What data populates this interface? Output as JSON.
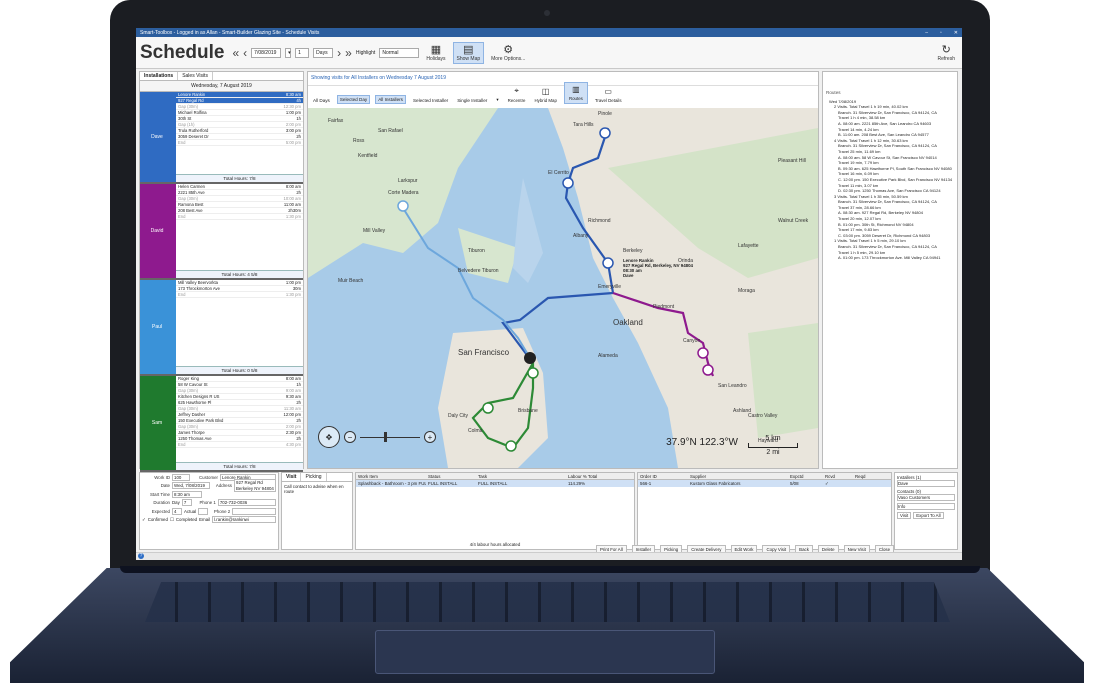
{
  "window": {
    "title": "Smart-Toolbox - Logged in as Allan - Smart-Builder Glazing Site - Schedule Visits"
  },
  "toolbar": {
    "heading": "Schedule",
    "date_value": "7/08/2019",
    "days_count": "1",
    "days_unit": "Days",
    "highlight_label": "Highlight",
    "highlight_value": "Normal",
    "holidays_label": "Holidays",
    "showmap_label": "Show Map",
    "moreoptions_label": "More Options...",
    "refresh_label": "Refresh"
  },
  "left": {
    "tabs": [
      "Installations",
      "Sales Visits"
    ],
    "day_header": "Wednesday, 7 August 2019",
    "installers": [
      {
        "name": "Dave",
        "color": "#2f6bc2",
        "jobs": [
          {
            "t": "Lenore Rankin",
            "v": "8:30 am",
            "sel": true
          },
          {
            "t": "927 Regal Rd",
            "v": "4h",
            "sel": true
          },
          {
            "t": "Gap (30m)",
            "v": "12:30 pm",
            "gap": true
          },
          {
            "t": "Michael Rolfina",
            "v": "1:00 pm"
          },
          {
            "t": "30th St",
            "v": "1h"
          },
          {
            "t": "Gap (1h)",
            "v": "2:00 pm",
            "gap": true
          },
          {
            "t": "Trula Rutherford",
            "v": "3:00 pm"
          },
          {
            "t": "3059 Deseret Dr",
            "v": "2h"
          },
          {
            "t": "End",
            "v": "5:00 pm",
            "gap": true
          }
        ],
        "total": "Total Hours: 7/8"
      },
      {
        "name": "David",
        "color": "#8e1a8e",
        "jobs": [
          {
            "t": "Helen Carmen",
            "v": "8:00 am"
          },
          {
            "t": "2221 85th Ave",
            "v": "2h"
          },
          {
            "t": "Gap (30m)",
            "v": "10:00 am",
            "gap": true
          },
          {
            "t": "Ramona Best",
            "v": "11:00 am"
          },
          {
            "t": "208 Best Ave",
            "v": "2h30m"
          },
          {
            "t": "End",
            "v": "1:30 pm",
            "gap": true
          }
        ],
        "total": "Total Hours: 4 5/8"
      },
      {
        "name": "Paul",
        "color": "#3a92d8",
        "jobs": [
          {
            "t": "Mill Valley Beervorkta",
            "v": "1:00 pm"
          },
          {
            "t": "173 Throckmorton Ave",
            "v": "30m"
          },
          {
            "t": "End",
            "v": "1:30 pm",
            "gap": true
          }
        ],
        "total": "Total Hours: 0 5/8"
      },
      {
        "name": "Sam",
        "color": "#1f7a2e",
        "jobs": [
          {
            "t": "Roger King",
            "v": "8:00 am"
          },
          {
            "t": "58 W Cavour St",
            "v": "1h"
          },
          {
            "t": "Gap (30m)",
            "v": "9:00 am",
            "gap": true
          },
          {
            "t": "Kitchen Designs R US",
            "v": "9:30 am"
          },
          {
            "t": "625 Hawthorne Pl",
            "v": "2h"
          },
          {
            "t": "Gap (30m)",
            "v": "11:30 am",
            "gap": true
          },
          {
            "t": "Jeffrey Dasher",
            "v": "12:00 pm"
          },
          {
            "t": "150 Executive Park Blvd",
            "v": "2h"
          },
          {
            "t": "Gap (30m)",
            "v": "2:00 pm",
            "gap": true
          },
          {
            "t": "James Thorpe",
            "v": "2:30 pm"
          },
          {
            "t": "1250 Thomas Ave",
            "v": "2h"
          },
          {
            "t": "End",
            "v": "4:30 pm",
            "gap": true
          }
        ],
        "total": "Total Hours: 7/8"
      }
    ]
  },
  "map": {
    "header": "Showing visits for All Installers on Wednesday 7 August 2019",
    "tools": [
      "All Days",
      "Selected Day",
      "All Installers",
      "Selected Installer",
      "Single Installer",
      "Recentre",
      "Hybrid Map",
      "Routes",
      "Travel Details"
    ],
    "labels": [
      "Fairfax",
      "San Rafael",
      "Ross",
      "Kentfield",
      "Larkspur",
      "Corte Madera",
      "Mill Valley",
      "Muir Beach",
      "Tiburon",
      "Belvedere Tiburon",
      "Richmond",
      "El Cerrito",
      "Albany",
      "Berkeley",
      "Emeryville",
      "Piedmont",
      "Oakland",
      "Alameda",
      "San Francisco",
      "Daly City",
      "Brisbane",
      "Colma",
      "San Leandro",
      "Hayward",
      "Castro Valley",
      "Ashland",
      "Moraga",
      "Lafayette",
      "Orinda",
      "Canyon",
      "Walnut Creek",
      "Pleasant Hill",
      "Pinole",
      "Tara Hills"
    ],
    "callout": [
      "Lenore Rankin",
      "927 Regal Rd, Berkeley, NV 94804",
      "08:30 am",
      "Dave"
    ],
    "coords": "37.9°N  122.3°W",
    "scale_km": "5 km",
    "scale_mi": "2 mi"
  },
  "routes": {
    "title": "Routes",
    "lines": [
      {
        "lvl": 1,
        "t": "Wed 7/08/2019"
      },
      {
        "lvl": 2,
        "t": "2 Visits. Total Travel 1 h 19 min, 40.02 km"
      },
      {
        "lvl": 3,
        "t": "Branch. 31 Silverview Dr, San Francisco, CA 94124, CA"
      },
      {
        "lvl": 3,
        "t": "Travel 1 h 4 min, 38.58 km"
      },
      {
        "lvl": 3,
        "t": "A. 08:00 am. 2221 85th Ave, San Leandro CA 94603"
      },
      {
        "lvl": 3,
        "t": "Travel 14 min, 4.24 km"
      },
      {
        "lvl": 3,
        "t": "B. 11:00 am. 208 Best Ave, San Leandro CA 94577"
      },
      {
        "lvl": 2,
        "t": "4 Visits. Total Travel 1 h 12 min, 30.63 km"
      },
      {
        "lvl": 3,
        "t": "Branch. 31 Silverview Dr, San Francisco, CA 94124, CA"
      },
      {
        "lvl": 3,
        "t": "Travel 25 min, 11.69 km"
      },
      {
        "lvl": 3,
        "t": "A. 08:00 am. 58 W Cavour St, San Francisco NV 94014"
      },
      {
        "lvl": 3,
        "t": "Travel 19 min, 7.79 km"
      },
      {
        "lvl": 3,
        "t": "B. 09:30 am. 625 Hawthorne Pl, South San Francisco NV 94080"
      },
      {
        "lvl": 3,
        "t": "Travel 16 min, 6.09 km"
      },
      {
        "lvl": 3,
        "t": "C. 12:00 pm. 150 Executive Park Blvd, San Francisco NV 94134"
      },
      {
        "lvl": 3,
        "t": "Travel 11 min, 3.07 km"
      },
      {
        "lvl": 3,
        "t": "D. 02:30 pm. 1250 Thomas Ave, San Francisco CA 94124"
      },
      {
        "lvl": 2,
        "t": "3 Visits. Total Travel 1 h 35 min, 50.59 km"
      },
      {
        "lvl": 3,
        "t": "Branch. 31 Silverview Dr, San Francisco, CA 94124, CA"
      },
      {
        "lvl": 3,
        "t": "Travel 37 min, 28.66 km"
      },
      {
        "lvl": 3,
        "t": "A. 08:30 am. 927 Regal Rd, Berkeley NV 94804"
      },
      {
        "lvl": 3,
        "t": "Travel 20 min, 12.07 km"
      },
      {
        "lvl": 3,
        "t": "B. 01:00 pm. 30th St, Richmond NV 94804"
      },
      {
        "lvl": 3,
        "t": "Travel 17 min, 9.83 km"
      },
      {
        "lvl": 3,
        "t": "C. 03:00 pm. 3059 Deseret Dr, Richmond CA 94803"
      },
      {
        "lvl": 2,
        "t": "1 Visits. Total Travel 1 h 5 min, 29.10 km"
      },
      {
        "lvl": 3,
        "t": "Branch. 31 Silverview Dr, San Francisco, CA 94124, CA"
      },
      {
        "lvl": 3,
        "t": "Travel 1 h 5 min, 29.10 km"
      },
      {
        "lvl": 3,
        "t": "A. 01:00 pm. 173 Throckmorton Ave. Mill Valley CA 94941"
      }
    ]
  },
  "bottom": {
    "work_id_label": "Work ID",
    "work_id": "100",
    "customer_label": "Customer",
    "customer": "Lenore Rankin",
    "date_label": "Date",
    "date": "Wed, 7/08/2019",
    "address_label": "Address",
    "address": "927 Regal Rd Berkeley NV 94804",
    "start_label": "Start Time",
    "start": "8:30 am",
    "duration_label": "Duration",
    "day_label": "Day",
    "day": "7",
    "phone1_label": "Phone 1",
    "phone1": "702-732-0036",
    "expected_label": "Expected",
    "expected": "4",
    "actual_label": "Actual",
    "phone2_label": "Phone 2",
    "confirmed_label": "Confirmed",
    "completed_label": "Completed",
    "email_label": "Email",
    "email": "l.rankin@rankinwi",
    "visit_tab": "Visit",
    "picking_tab": "Picking",
    "note": "Call contact to advise when en route",
    "work_cols": [
      "Work Item",
      "Status",
      "Task",
      "Labour % Total"
    ],
    "work_row": [
      "Splashback - Bathroom - 3 pm FULL INSTALL",
      "FULL INSTALL",
      "FULL INSTALL",
      "114.29%"
    ],
    "work_footer": "4/4 labour hours allocated",
    "order_cols": [
      "Order ID",
      "Supplier",
      "Expctd",
      "Rcvd",
      "Reqd"
    ],
    "order_row": [
      "566-1",
      "Kustom Glass Fabricators",
      "5/08",
      "",
      ""
    ],
    "installers_label": "Installers (1)",
    "installer_val": "Dave",
    "contacts_label": "Contacts (0)",
    "contact_val": "Vaso Customers",
    "info_val": "Info",
    "visit_btn": "Visit",
    "export_btn": "Export To All"
  },
  "actions": [
    "Print For All",
    "Installer",
    "Picking",
    "Create Delivery",
    "Edit Work",
    "Copy Visit",
    "Back",
    "Delete",
    "New Visit",
    "Close"
  ]
}
